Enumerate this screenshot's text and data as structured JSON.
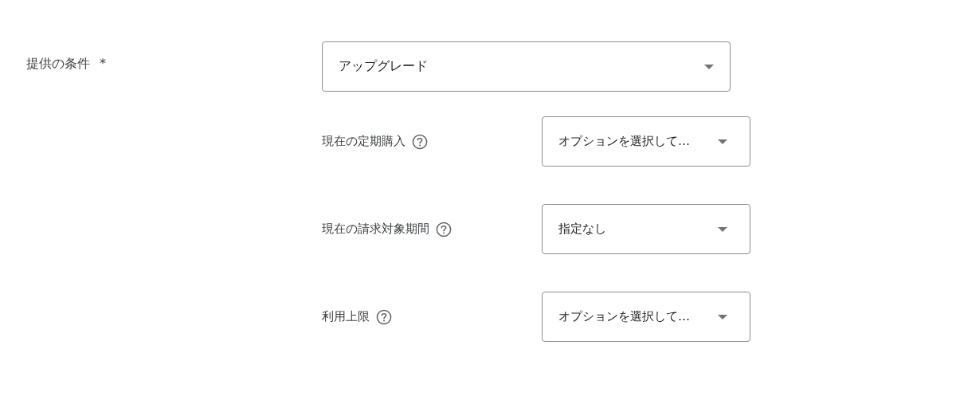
{
  "offer_condition": {
    "label": "提供の条件",
    "required_mark": "*",
    "value": "アップグレード"
  },
  "sub_fields": [
    {
      "label": "現在の定期購入",
      "help": true,
      "value": "オプションを選択して…"
    },
    {
      "label": "現在の請求対象期間",
      "help": true,
      "value": "指定なし"
    },
    {
      "label": "利用上限",
      "help": true,
      "value": "オプションを選択して…"
    }
  ]
}
